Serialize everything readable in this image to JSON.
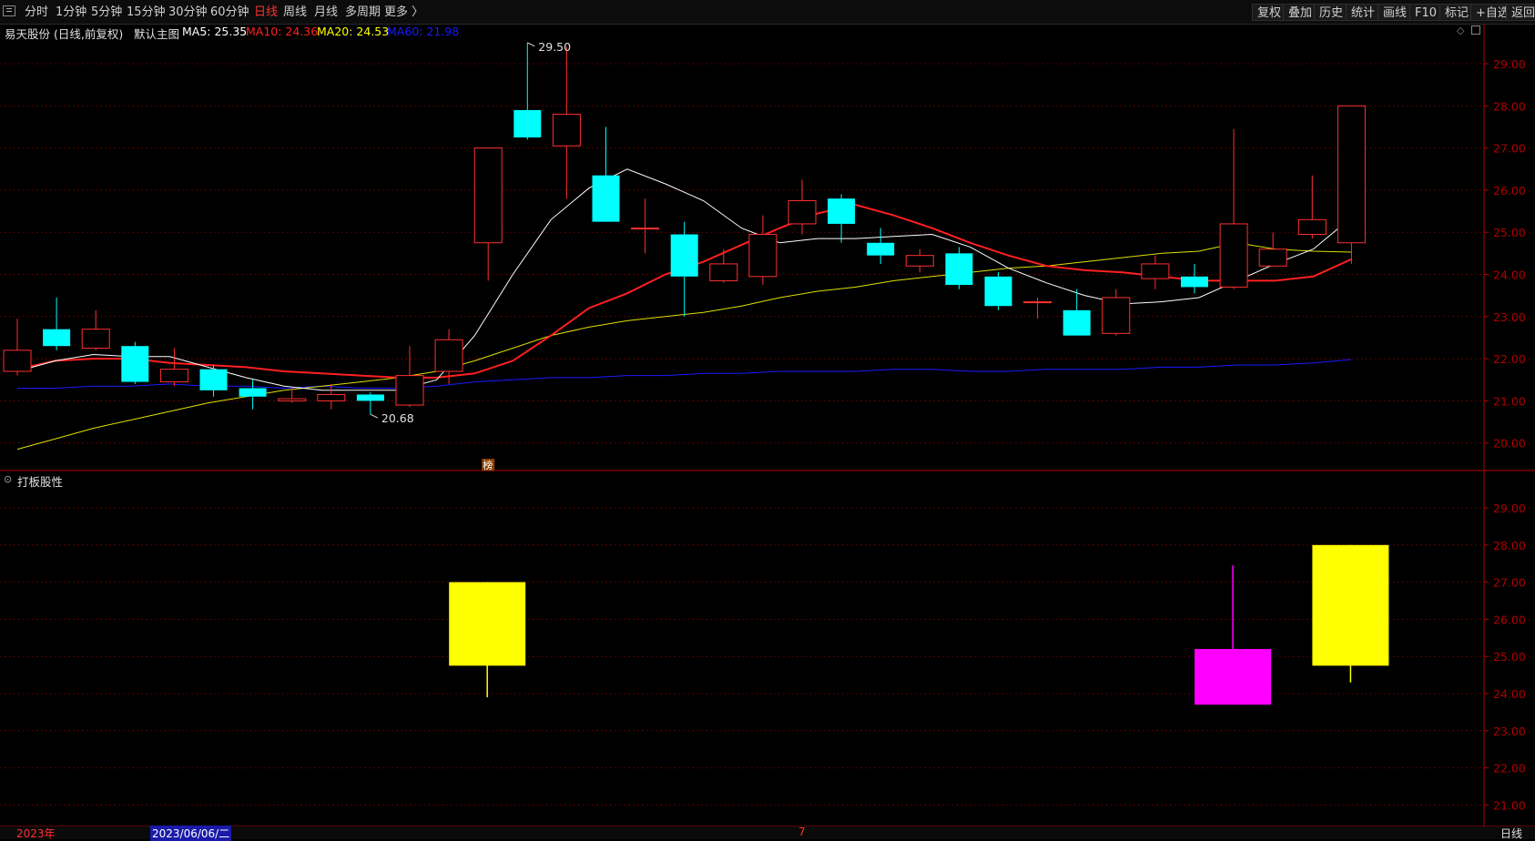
{
  "toolbar": {
    "periods": [
      "分时",
      "1分钟",
      "5分钟",
      "15分钟",
      "30分钟",
      "60分钟",
      "日线",
      "周线",
      "月线",
      "多周期",
      "更多 〉"
    ],
    "active_period": "日线",
    "right_buttons": [
      "复权",
      "叠加",
      "历史",
      "统计",
      "画线",
      "F10",
      "标记",
      "+自选",
      "返回"
    ]
  },
  "main_panel": {
    "stock_title": "易天股份 (日线,前复权)",
    "template_label": "默认主图",
    "ma": [
      {
        "label": "MA5: 25.35",
        "color": "#ffffff"
      },
      {
        "label": "MA10: 24.36",
        "color": "#ff2020"
      },
      {
        "label": "MA20: 24.53",
        "color": "#ffff00"
      },
      {
        "label": "MA60: 21.98",
        "color": "#1a1aff"
      }
    ],
    "high_marker": "29.50",
    "low_marker": "20.68",
    "bang_marker": "榜",
    "y_ticks": [
      "29.00",
      "28.00",
      "27.00",
      "26.00",
      "25.00",
      "24.00",
      "23.00",
      "22.00",
      "21.00",
      "20.00"
    ]
  },
  "sub_panel": {
    "title": "打板股性",
    "y_ticks": [
      "29.00",
      "28.00",
      "27.00",
      "26.00",
      "25.00",
      "24.00",
      "23.00",
      "22.00",
      "21.00"
    ]
  },
  "footer": {
    "year_label": "2023年",
    "date_label": "2023/06/06/二",
    "month_label": "7",
    "period_label": "日线"
  },
  "colors": {
    "up": "#ff3030",
    "down": "#00ffff",
    "grid": "#5a0000",
    "axis": "#b00000",
    "sub_yellow": "#ffff00",
    "sub_magenta": "#ff00ff"
  },
  "chart_data": {
    "type": "candlestick",
    "candles": [
      {
        "o": 21.7,
        "h": 22.95,
        "l": 21.6,
        "c": 22.2
      },
      {
        "o": 22.7,
        "h": 23.45,
        "l": 22.2,
        "c": 22.3
      },
      {
        "o": 22.25,
        "h": 23.15,
        "l": 22.2,
        "c": 22.7
      },
      {
        "o": 22.3,
        "h": 22.4,
        "l": 21.4,
        "c": 21.45
      },
      {
        "o": 21.45,
        "h": 22.25,
        "l": 21.35,
        "c": 21.75
      },
      {
        "o": 21.75,
        "h": 21.85,
        "l": 21.1,
        "c": 21.25
      },
      {
        "o": 21.3,
        "h": 21.5,
        "l": 20.8,
        "c": 21.1
      },
      {
        "o": 21.0,
        "h": 21.3,
        "l": 20.95,
        "c": 21.05
      },
      {
        "o": 21.0,
        "h": 21.4,
        "l": 20.8,
        "c": 21.15
      },
      {
        "o": 21.15,
        "h": 21.2,
        "l": 20.68,
        "c": 21.0
      },
      {
        "o": 20.9,
        "h": 22.3,
        "l": 20.85,
        "c": 21.6
      },
      {
        "o": 21.7,
        "h": 22.7,
        "l": 21.4,
        "c": 22.45
      },
      {
        "o": 24.75,
        "h": 27.0,
        "l": 23.85,
        "c": 27.0
      },
      {
        "o": 27.9,
        "h": 29.5,
        "l": 27.2,
        "c": 27.25
      },
      {
        "o": 27.05,
        "h": 29.4,
        "l": 25.8,
        "c": 27.8
      },
      {
        "o": 26.35,
        "h": 27.5,
        "l": 25.25,
        "c": 25.25
      },
      {
        "o": 25.1,
        "h": 25.8,
        "l": 24.5,
        "c": 25.1
      },
      {
        "o": 24.95,
        "h": 25.25,
        "l": 23.0,
        "c": 23.95
      },
      {
        "o": 23.85,
        "h": 24.6,
        "l": 23.8,
        "c": 24.25
      },
      {
        "o": 23.95,
        "h": 25.4,
        "l": 23.75,
        "c": 24.95
      },
      {
        "o": 25.2,
        "h": 26.25,
        "l": 24.95,
        "c": 25.75
      },
      {
        "o": 25.8,
        "h": 25.9,
        "l": 24.75,
        "c": 25.2
      },
      {
        "o": 24.75,
        "h": 25.1,
        "l": 24.25,
        "c": 24.45
      },
      {
        "o": 24.2,
        "h": 24.6,
        "l": 24.05,
        "c": 24.45
      },
      {
        "o": 24.5,
        "h": 24.65,
        "l": 23.65,
        "c": 23.75
      },
      {
        "o": 23.95,
        "h": 24.05,
        "l": 23.15,
        "c": 23.25
      },
      {
        "o": 23.35,
        "h": 23.45,
        "l": 22.95,
        "c": 23.35
      },
      {
        "o": 23.15,
        "h": 23.65,
        "l": 22.55,
        "c": 22.55
      },
      {
        "o": 22.6,
        "h": 23.65,
        "l": 22.55,
        "c": 23.45
      },
      {
        "o": 23.9,
        "h": 24.45,
        "l": 23.65,
        "c": 24.25
      },
      {
        "o": 23.95,
        "h": 24.25,
        "l": 23.55,
        "c": 23.7
      },
      {
        "o": 23.7,
        "h": 27.45,
        "l": 23.65,
        "c": 25.2
      },
      {
        "o": 24.2,
        "h": 25.0,
        "l": 24.2,
        "c": 24.6
      },
      {
        "o": 24.95,
        "h": 26.35,
        "l": 24.85,
        "c": 25.3
      },
      {
        "o": 24.75,
        "h": 28.0,
        "l": 24.25,
        "c": 28.0
      }
    ],
    "ma5": [
      21.7,
      21.95,
      22.1,
      22.05,
      22.05,
      21.8,
      21.55,
      21.35,
      21.25,
      21.25,
      21.25,
      21.5,
      22.55,
      24.0,
      25.3,
      26.05,
      26.5,
      26.15,
      25.75,
      25.1,
      24.75,
      24.85,
      24.85,
      24.9,
      24.95,
      24.65,
      24.15,
      23.8,
      23.5,
      23.3,
      23.35,
      23.45,
      23.85,
      24.25,
      24.6,
      25.35
    ],
    "ma10": [
      21.75,
      21.95,
      22.0,
      22.0,
      21.9,
      21.85,
      21.8,
      21.7,
      21.65,
      21.6,
      21.55,
      21.55,
      21.65,
      21.95,
      22.55,
      23.2,
      23.55,
      24.0,
      24.3,
      24.7,
      25.1,
      25.45,
      25.65,
      25.4,
      25.1,
      24.75,
      24.45,
      24.2,
      24.1,
      24.05,
      23.95,
      23.85,
      23.85,
      23.85,
      23.95,
      24.36
    ],
    "ma20": [
      19.85,
      20.1,
      20.35,
      20.55,
      20.75,
      20.95,
      21.1,
      21.25,
      21.35,
      21.45,
      21.55,
      21.7,
      21.95,
      22.25,
      22.55,
      22.75,
      22.9,
      23.0,
      23.1,
      23.25,
      23.45,
      23.6,
      23.7,
      23.85,
      23.95,
      24.05,
      24.15,
      24.2,
      24.3,
      24.4,
      24.5,
      24.55,
      24.75,
      24.6,
      24.55,
      24.53
    ],
    "ma60": [
      21.3,
      21.3,
      21.35,
      21.35,
      21.4,
      21.35,
      21.35,
      21.3,
      21.35,
      21.3,
      21.3,
      21.35,
      21.45,
      21.5,
      21.55,
      21.55,
      21.6,
      21.6,
      21.65,
      21.65,
      21.7,
      21.7,
      21.7,
      21.75,
      21.75,
      21.7,
      21.7,
      21.75,
      21.75,
      21.75,
      21.8,
      21.8,
      21.85,
      21.85,
      21.9,
      21.98
    ],
    "sub_bars": [
      {
        "index": 12,
        "o": 24.75,
        "h": 27.0,
        "l": 23.9,
        "c": 27.0,
        "color": "yellow"
      },
      {
        "index": 31,
        "o": 23.7,
        "h": 27.45,
        "l": 23.7,
        "c": 25.2,
        "color": "magenta"
      },
      {
        "index": 34,
        "o": 24.75,
        "h": 28.0,
        "l": 24.3,
        "c": 28.0,
        "color": "yellow"
      }
    ]
  }
}
